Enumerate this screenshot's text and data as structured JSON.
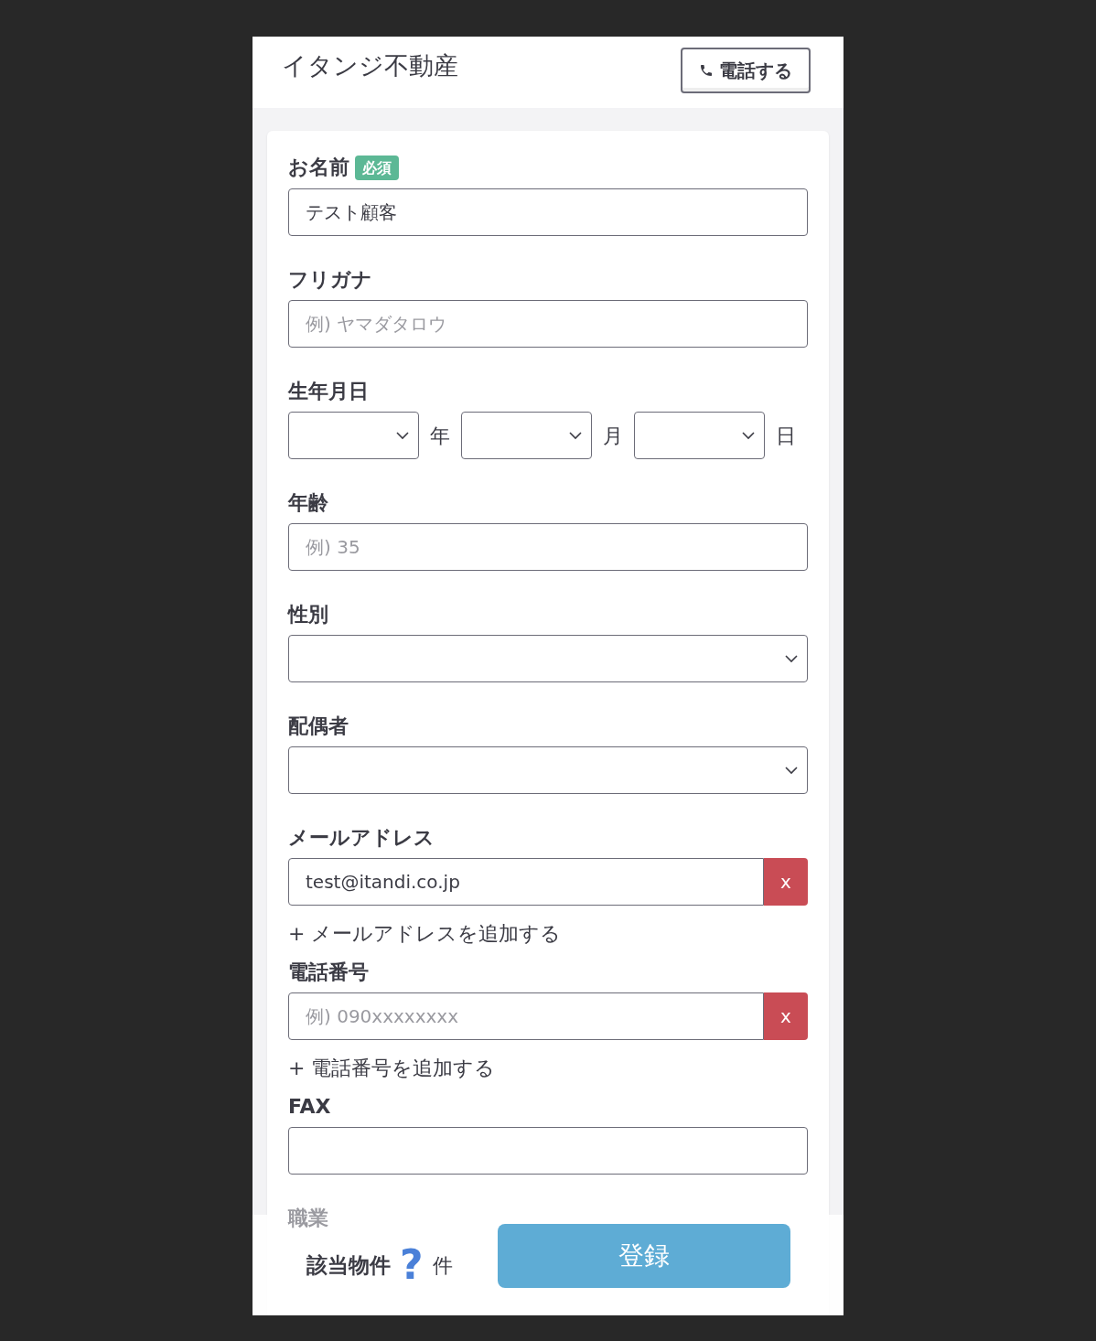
{
  "header": {
    "title": "イタンジ不動産",
    "call_button": "電話する"
  },
  "fields": [
    {
      "kind": "text",
      "label": "お名前",
      "badge": "必須",
      "value": "テスト顧客"
    },
    {
      "kind": "text",
      "label": "フリガナ",
      "placeholder": "例) ヤマダタロウ"
    },
    {
      "kind": "date",
      "label": "生年月日",
      "units": [
        "年",
        "月",
        "日"
      ]
    },
    {
      "kind": "text",
      "label": "年齢",
      "placeholder": "例) 35"
    },
    {
      "kind": "select",
      "label": "性別"
    },
    {
      "kind": "select",
      "label": "配偶者"
    },
    {
      "kind": "multi",
      "label": "メールアドレス",
      "value": "test@itandi.co.jp",
      "remove": "x",
      "add_link": "+ メールアドレスを追加する"
    },
    {
      "kind": "multi",
      "label": "電話番号",
      "placeholder": "例) 090xxxxxxxx",
      "remove": "x",
      "add_link": "+ 電話番号を追加する"
    },
    {
      "kind": "text",
      "label": "FAX"
    },
    {
      "kind": "covered",
      "label": "職業"
    }
  ],
  "footer": {
    "count_label": "該当物件",
    "count": "?",
    "unit": "件",
    "submit": "登録"
  }
}
